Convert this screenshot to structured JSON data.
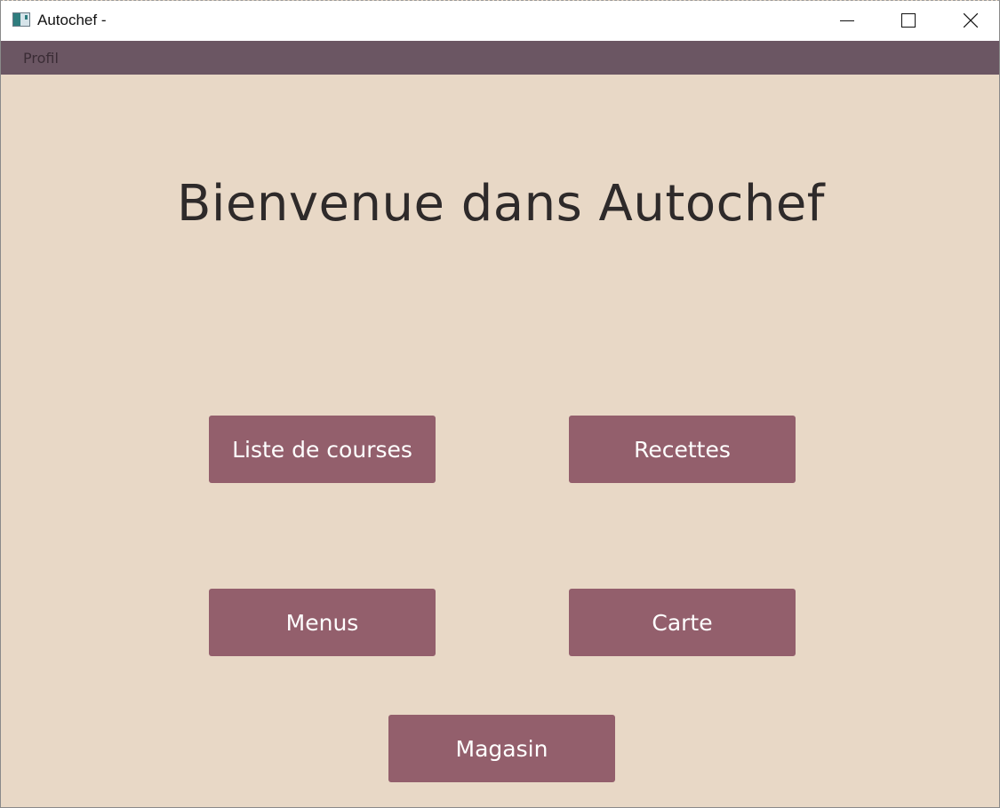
{
  "window": {
    "title": "Autochef -",
    "icon": "app-window-icon",
    "controls": {
      "minimize": "minimize-icon",
      "maximize": "maximize-icon",
      "close": "close-icon"
    }
  },
  "menubar": {
    "items": [
      {
        "label": "Profil"
      }
    ]
  },
  "main": {
    "title": "Bienvenue dans Autochef",
    "buttons": {
      "liste_de_courses": "Liste de courses",
      "recettes": "Recettes",
      "menus": "Menus",
      "carte": "Carte",
      "magasin": "Magasin"
    }
  },
  "colors": {
    "background": "#e8d8c6",
    "menubar": "#6b5663",
    "button": "#935f6c",
    "button_text": "#ffffff",
    "title_text": "#2e2a2a"
  }
}
